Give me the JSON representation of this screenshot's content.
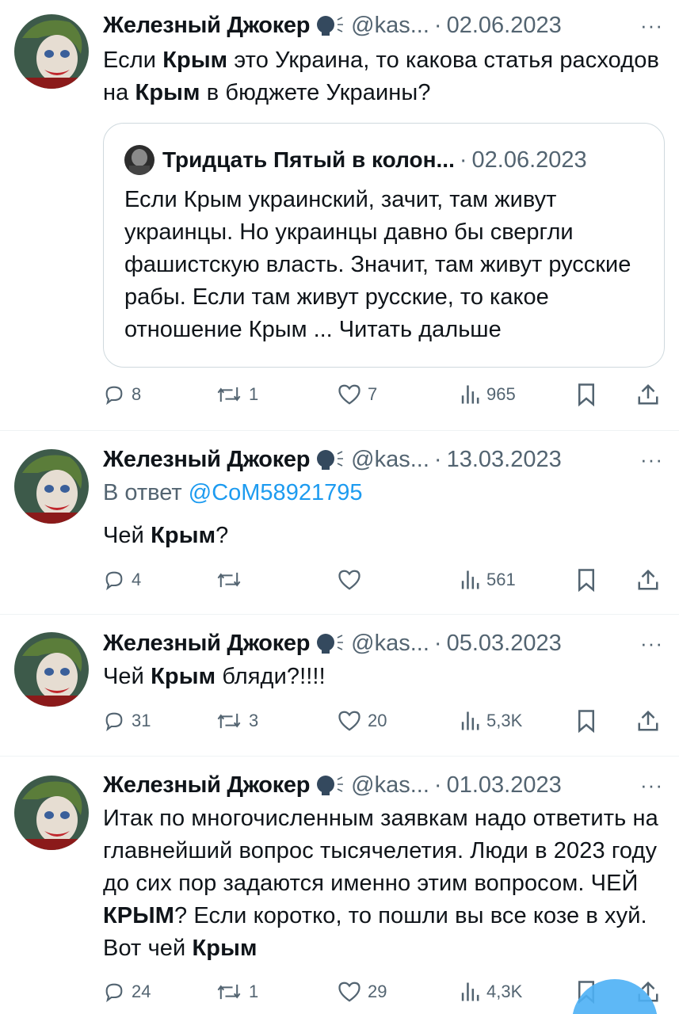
{
  "tweets": [
    {
      "author": "Железный Джокер",
      "handle": "@kas...",
      "sep": "·",
      "date": "02.06.2023",
      "more": "···",
      "text_parts": [
        "Если ",
        "Крым",
        " это Украина, то какова статья расходов на ",
        "Крым",
        " в бюджете Украины?"
      ],
      "quote": {
        "author": "Тридцать Пятый в колон...",
        "sep": "·",
        "date": "02.06.2023",
        "text": "Если Крым украинский, зачит, там живут украинцы. Но украинцы давно бы свергли фашистскую власть. Значит, там живут русские рабы. Если там живут русские, то какое отношение Крым ... Читать дальше"
      },
      "stats": {
        "replies": "8",
        "retweets": "1",
        "likes": "7",
        "views": "965"
      }
    },
    {
      "author": "Железный Джокер",
      "handle": "@kas...",
      "sep": "·",
      "date": "13.03.2023",
      "more": "···",
      "reply_prefix": "В ответ",
      "reply_handle": "@CoM58921795",
      "text_parts": [
        "Чей ",
        "Крым",
        "?"
      ],
      "stats": {
        "replies": "4",
        "retweets": "",
        "likes": "",
        "views": "561"
      }
    },
    {
      "author": "Железный Джокер",
      "handle": "@kas...",
      "sep": "·",
      "date": "05.03.2023",
      "more": "···",
      "text_parts": [
        "Чей ",
        "Крым",
        " бляди?!!!!"
      ],
      "stats": {
        "replies": "31",
        "retweets": "3",
        "likes": "20",
        "views": "5,3K"
      }
    },
    {
      "author": "Железный Джокер",
      "handle": "@kas...",
      "sep": "·",
      "date": "01.03.2023",
      "more": "···",
      "text_parts": [
        "Итак по многочисленным заявкам надо ответить на главнейший вопрос тысячелетия. Люди в 2023 году до сих пор задаются именно этим вопросом. ЧЕЙ ",
        "КРЫМ",
        "? Если коротко, то пошли вы все козе в хуй. Вот чей ",
        "Крым",
        ""
      ],
      "stats": {
        "replies": "24",
        "retweets": "1",
        "likes": "29",
        "views": "4,3K"
      }
    }
  ],
  "colors": {
    "link": "#1d9bf0",
    "muted": "#536471",
    "text": "#0f1419",
    "border": "#cfd9de",
    "fab": "#4cb0f5"
  }
}
